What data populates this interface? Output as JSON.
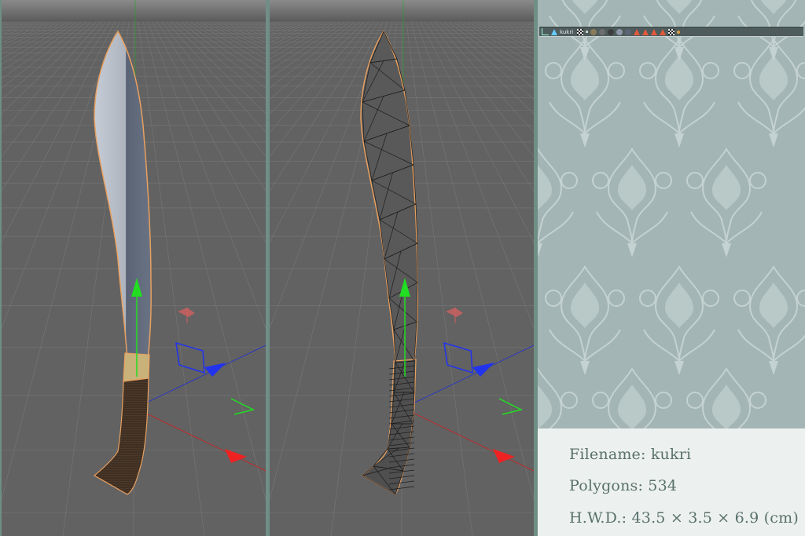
{
  "viewports": [
    {
      "name": "shaded",
      "shading": "textured"
    },
    {
      "name": "wireframe",
      "shading": "wire"
    }
  ],
  "object_bar": {
    "object_name": "kukri",
    "icons": [
      "axis-icon",
      "null-object-icon",
      "checker-tag-icon",
      "material-ball-icon",
      "material-ball-icon",
      "material-ball-icon",
      "material-ball-icon",
      "material-ball-icon",
      "warning-tag-icon",
      "warning-tag-icon",
      "warning-tag-icon",
      "warning-tag-icon",
      "checker-tag-icon",
      "dot-icon"
    ]
  },
  "info": {
    "filename": "Filename: kukri",
    "polygons": "Polygons: 534",
    "dimensions": "H.W.D.: 43.5 × 3.5 × 6.9 (cm)"
  },
  "colors": {
    "viewport_bg": "#5f5f5f",
    "grid_line": "#7a7a7a",
    "selection_outline": "#e8a060",
    "axis_y": "#22dd22",
    "axis_x": "#ee2222",
    "axis_z": "#2233ee",
    "panel_bg": "#a3b5b4",
    "info_text": "#59706b"
  }
}
